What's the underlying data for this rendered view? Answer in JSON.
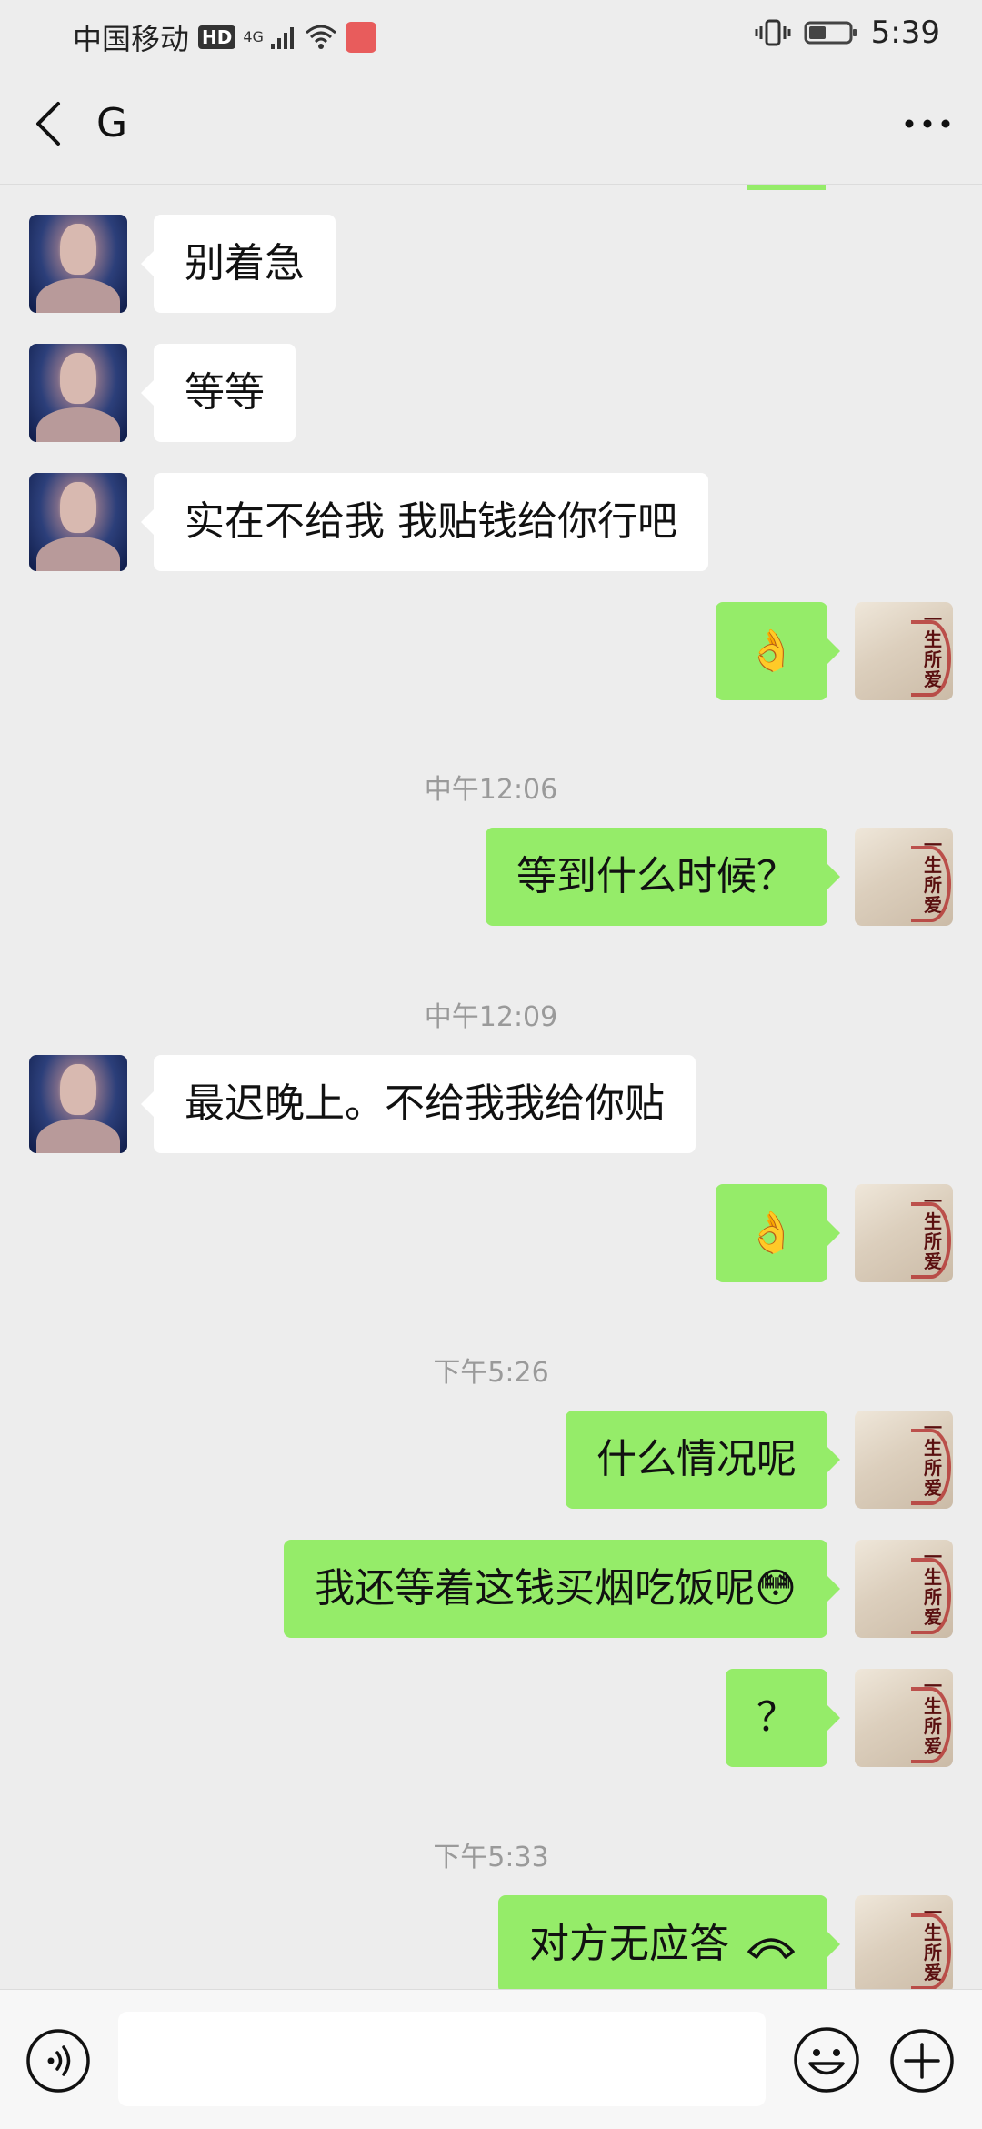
{
  "status_bar": {
    "carrier": "中国移动",
    "hd_badge": "HD",
    "network": "4G",
    "time": "5:39"
  },
  "header": {
    "title": "G"
  },
  "messages": [
    {
      "side": "in",
      "text": "别着急"
    },
    {
      "side": "in",
      "text": "等等"
    },
    {
      "side": "in",
      "text": "实在不给我 我贴钱给你行吧"
    },
    {
      "side": "out",
      "text": "👌"
    },
    {
      "timestamp": "中午12:06"
    },
    {
      "side": "out",
      "text": "等到什么时候？"
    },
    {
      "timestamp": "中午12:09"
    },
    {
      "side": "in",
      "text": "最迟晚上。不给我我给你贴"
    },
    {
      "side": "out",
      "text": "👌"
    },
    {
      "timestamp": "下午5:26"
    },
    {
      "side": "out",
      "text": "什么情况呢"
    },
    {
      "side": "out",
      "text": "我还等着这钱买烟吃饭呢😳"
    },
    {
      "side": "out",
      "text": "？"
    },
    {
      "timestamp": "下午5:33"
    },
    {
      "side": "out",
      "text": "对方无应答",
      "icon": "hangup-icon"
    }
  ],
  "avatar_me_text": "一生所爱",
  "input_bar": {
    "voice_icon": "voice-icon",
    "emoji_icon": "smiley-icon",
    "plus_icon": "plus-icon",
    "input_value": ""
  },
  "colors": {
    "background": "#ededed",
    "incoming_bubble": "#ffffff",
    "outgoing_bubble": "#95ec69",
    "timestamp_text": "#9a9a9a"
  }
}
